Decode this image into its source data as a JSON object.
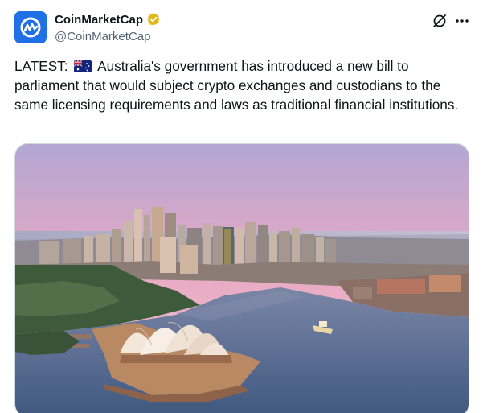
{
  "account": {
    "display_name": "CoinMarketCap",
    "handle": "@CoinMarketCap",
    "verified": true,
    "avatar_icon": "coinmarketcap-logo-icon",
    "brand_color": "#1f6fe5",
    "badge_color": "#e2b719"
  },
  "actions": {
    "grok_icon": "grok-icon",
    "more_icon": "more-dots-icon"
  },
  "tweet": {
    "text_prefix": "LATEST:",
    "flag_icon": "australia-flag-icon",
    "text_body": "Australia's government has introduced a new bill to parliament that would subject crypto exchanges and custodians to the same licensing requirements and laws as traditional financial institutions."
  },
  "media": {
    "subject": "aerial-photo-sydney-harbour-opera-house"
  }
}
